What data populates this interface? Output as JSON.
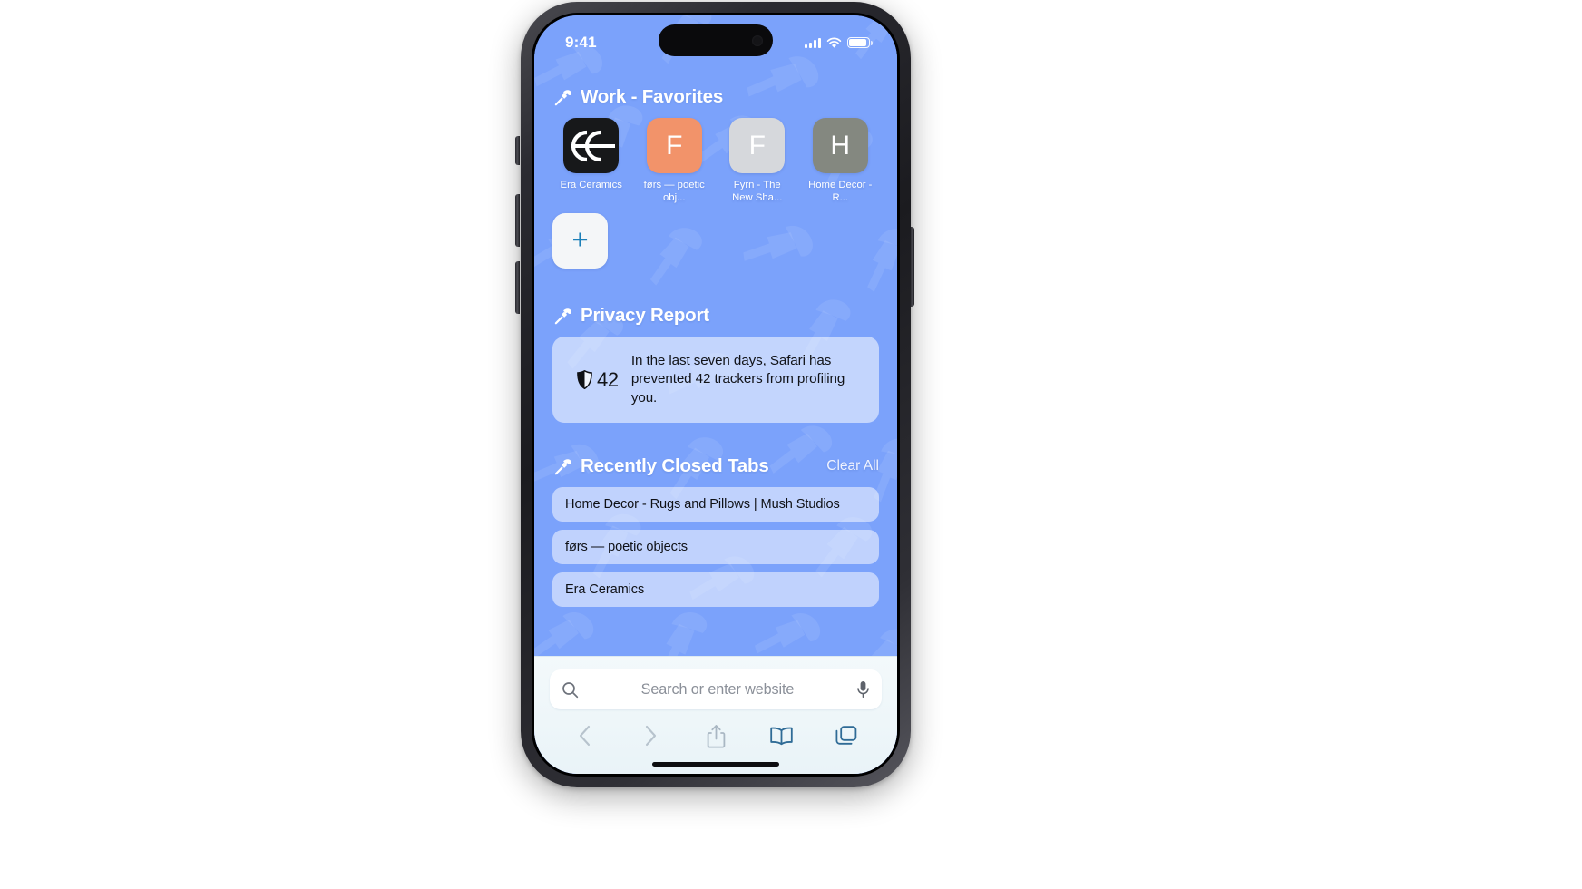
{
  "status_bar": {
    "time": "9:41",
    "cellular_icon": "cellular-bars-icon",
    "wifi_icon": "wifi-icon",
    "battery_icon": "battery-icon"
  },
  "sections": {
    "favorites": {
      "icon": "hammer-icon",
      "title": "Work - Favorites",
      "items": [
        {
          "label": "Era Ceramics",
          "tile_text": "",
          "tile_color": "#17181a",
          "text_color": "#ffffff",
          "logo": "era-ceramics-logo"
        },
        {
          "label": "førs — poetic obj...",
          "tile_text": "F",
          "tile_color": "#f2936a",
          "text_color": "#ffffff",
          "logo": ""
        },
        {
          "label": "Fyrn - The New Sha...",
          "tile_text": "F",
          "tile_color": "#d6d8dc",
          "text_color": "#ffffff",
          "logo": ""
        },
        {
          "label": "Home Decor - R...",
          "tile_text": "H",
          "tile_color": "#848880",
          "text_color": "#ffffff",
          "logo": ""
        }
      ],
      "add_button": {
        "icon": "plus-icon",
        "label": "+"
      }
    },
    "privacy_report": {
      "icon": "hammer-icon",
      "title": "Privacy Report",
      "shield_icon": "shield-icon",
      "tracker_count": "42",
      "description": "In the last seven days, Safari has prevented 42 trackers from profiling you."
    },
    "recently_closed": {
      "icon": "hammer-icon",
      "title": "Recently Closed Tabs",
      "clear_all_label": "Clear All",
      "tabs": [
        {
          "title": "Home Decor - Rugs and Pillows | Mush Studios"
        },
        {
          "title": "førs — poetic objects"
        },
        {
          "title": "Era Ceramics"
        }
      ]
    }
  },
  "search": {
    "placeholder": "Search or enter website",
    "search_icon": "search-icon",
    "mic_icon": "microphone-icon"
  },
  "toolbar": {
    "back": "back-chevron-icon",
    "forward": "forward-chevron-icon",
    "share": "share-icon",
    "bookmarks": "book-icon",
    "tabs": "tabs-icon"
  },
  "theme": {
    "wallpaper": "#7ba2fb",
    "accent": "#1c7fb8",
    "card": "rgba(255,255,255,0.55)",
    "bottom_bar": "#eef6f9"
  }
}
